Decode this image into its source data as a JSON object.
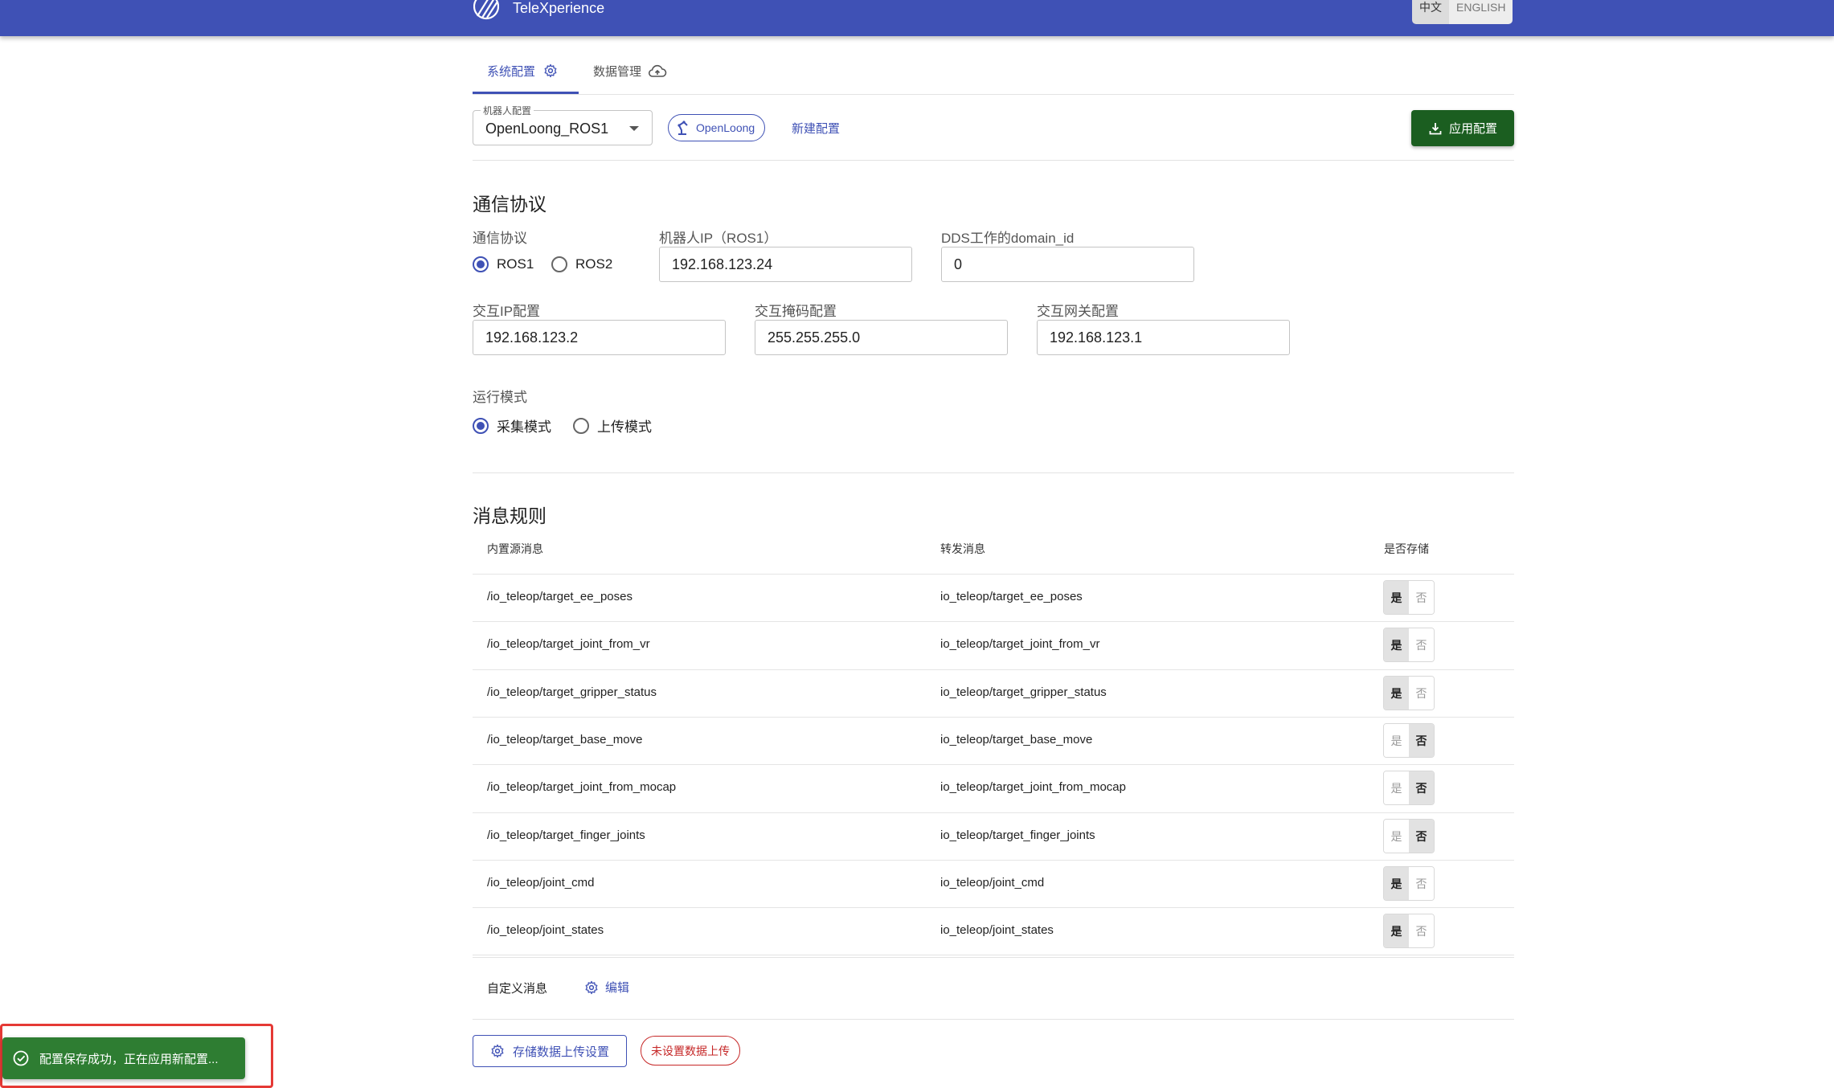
{
  "header": {
    "brand": "TeleXperience",
    "lang_zh": "中文",
    "lang_en": "ENGLISH",
    "bg_color": "#3f51b5"
  },
  "tabs": [
    {
      "label": "系统配置",
      "icon": "gear-icon",
      "active": true
    },
    {
      "label": "数据管理",
      "icon": "cloud-upload-icon",
      "active": false
    }
  ],
  "toolbar": {
    "robot_config_legend": "机器人配置",
    "robot_config_value": "OpenLoong_ROS1",
    "chip_label": "OpenLoong",
    "new_config": "新建配置",
    "apply": "应用配置",
    "apply_color": "#1b5e20"
  },
  "comm": {
    "title": "通信协议",
    "protocol_label": "通信协议",
    "ros1": "ROS1",
    "ros2": "ROS2",
    "selected": "ROS1",
    "robot_ip_label": "机器人IP（ROS1）",
    "robot_ip": "192.168.123.24",
    "domain_label": "DDS工作的domain_id",
    "domain_id": "0",
    "ip_label": "交互IP配置",
    "ip": "192.168.123.2",
    "mask_label": "交互掩码配置",
    "mask": "255.255.255.0",
    "gateway_label": "交互网关配置",
    "gateway": "192.168.123.1",
    "mode_label": "运行模式",
    "mode_collect": "采集模式",
    "mode_upload": "上传模式",
    "mode_selected": "采集模式"
  },
  "rules": {
    "title": "消息规则",
    "col_source": "内置源消息",
    "col_forward": "转发消息",
    "col_store": "是否存储",
    "yes": "是",
    "no": "否",
    "rows": [
      {
        "source": "/io_teleop/target_ee_poses",
        "forward": "io_teleop/target_ee_poses",
        "store": true
      },
      {
        "source": "/io_teleop/target_joint_from_vr",
        "forward": "io_teleop/target_joint_from_vr",
        "store": true
      },
      {
        "source": "/io_teleop/target_gripper_status",
        "forward": "io_teleop/target_gripper_status",
        "store": true
      },
      {
        "source": "/io_teleop/target_base_move",
        "forward": "io_teleop/target_base_move",
        "store": false
      },
      {
        "source": "/io_teleop/target_joint_from_mocap",
        "forward": "io_teleop/target_joint_from_mocap",
        "store": false
      },
      {
        "source": "/io_teleop/target_finger_joints",
        "forward": "io_teleop/target_finger_joints",
        "store": false
      },
      {
        "source": "/io_teleop/joint_cmd",
        "forward": "io_teleop/joint_cmd",
        "store": true
      },
      {
        "source": "/io_teleop/joint_states",
        "forward": "io_teleop/joint_states",
        "store": true
      }
    ],
    "custom_label": "自定义消息",
    "edit": "编辑"
  },
  "footer": {
    "storage_btn": "存储数据上传设置",
    "warn_chip": "未设置数据上传"
  },
  "toast": {
    "message": "配置保存成功，正在应用新配置...",
    "color": "#2e7d32"
  }
}
